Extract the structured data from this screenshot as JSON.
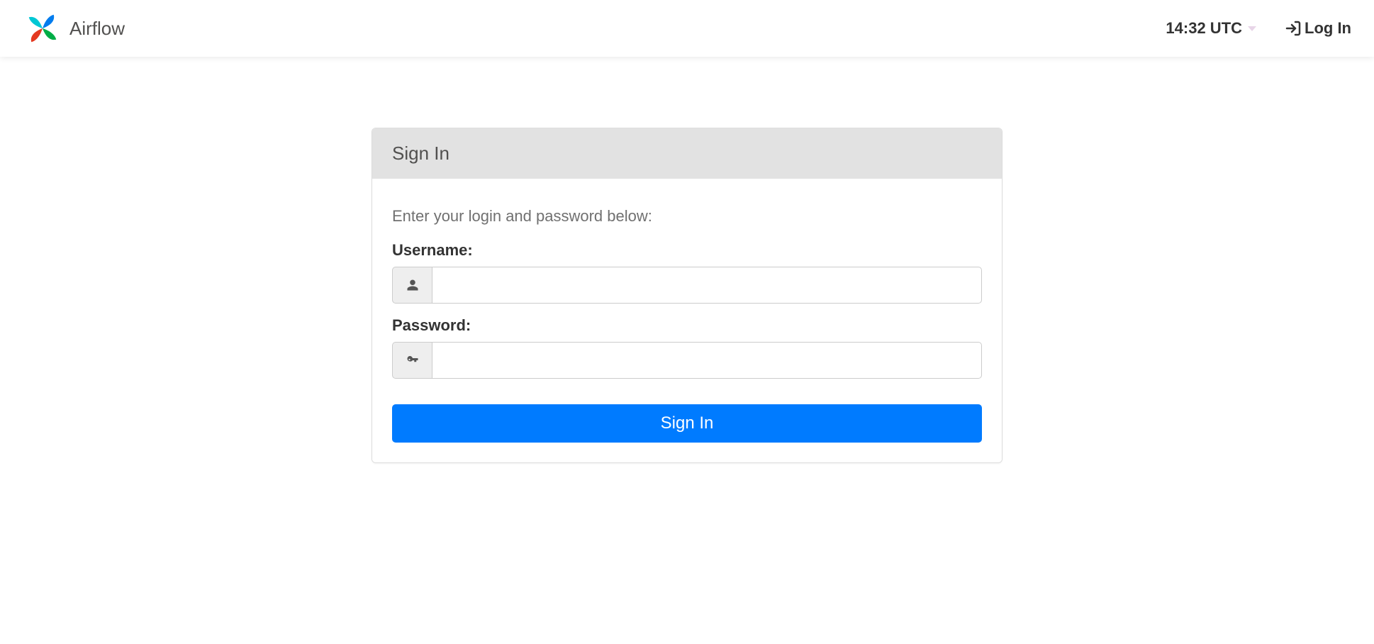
{
  "header": {
    "brand": "Airflow",
    "time": "14:32 UTC",
    "login_link": "Log In"
  },
  "panel": {
    "title": "Sign In",
    "help_text": "Enter your login and password below:",
    "username_label": "Username:",
    "password_label": "Password:",
    "username_value": "",
    "password_value": "",
    "submit_label": "Sign In"
  }
}
